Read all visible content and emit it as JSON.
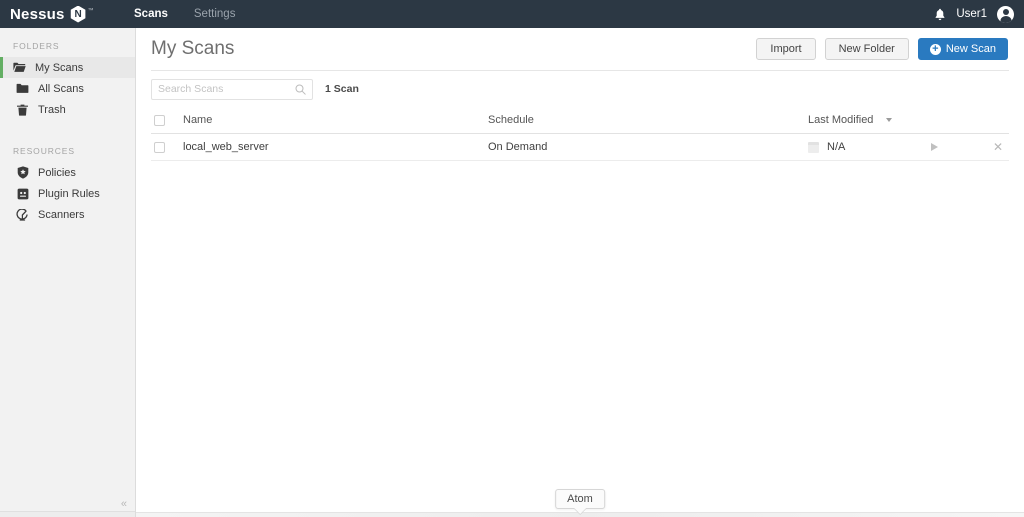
{
  "topnav": {
    "brand": "Nessus",
    "brand_badge": "N",
    "brand_tm": "™",
    "links": [
      {
        "label": "Scans",
        "active": true
      },
      {
        "label": "Settings",
        "active": false
      }
    ],
    "bell_icon": "bell-icon",
    "user": "User1",
    "avatar_icon": "user-avatar-icon",
    "bg_color": "#2c3844"
  },
  "sidebar": {
    "sections": [
      {
        "heading": "FOLDERS",
        "items": [
          {
            "label": "My Scans",
            "icon": "folder-open-icon",
            "active": true
          },
          {
            "label": "All Scans",
            "icon": "folder-icon",
            "active": false
          },
          {
            "label": "Trash",
            "icon": "trash-icon",
            "active": false
          }
        ]
      },
      {
        "heading": "RESOURCES",
        "items": [
          {
            "label": "Policies",
            "icon": "shield-icon",
            "active": false
          },
          {
            "label": "Plugin Rules",
            "icon": "plugin-icon",
            "active": false
          },
          {
            "label": "Scanners",
            "icon": "radar-icon",
            "active": false
          }
        ]
      }
    ],
    "collapse_label": "«",
    "active_accent": "#63ae63",
    "bg_color": "#f2f2f2"
  },
  "page": {
    "title": "My Scans",
    "actions": {
      "import": "Import",
      "new_folder": "New Folder",
      "new_scan": "New Scan",
      "new_scan_icon": "plus-circle-icon",
      "primary_color": "#2a7ac0"
    }
  },
  "toolbar": {
    "search_placeholder": "Search Scans",
    "search_value": "",
    "search_icon": "search-icon",
    "scan_count": "1 Scan"
  },
  "table": {
    "columns": {
      "name": "Name",
      "schedule": "Schedule",
      "last_modified": "Last Modified",
      "sort_icon": "caret-down-icon"
    },
    "rows": [
      {
        "checkbox": "row-checkbox",
        "name": "local_web_server",
        "schedule": "On Demand",
        "modified_icon": "calendar-icon",
        "last_modified": "N/A",
        "launch_icon": "play-icon",
        "delete_icon": "close-icon"
      }
    ]
  },
  "tooltip": {
    "label": "Atom"
  }
}
